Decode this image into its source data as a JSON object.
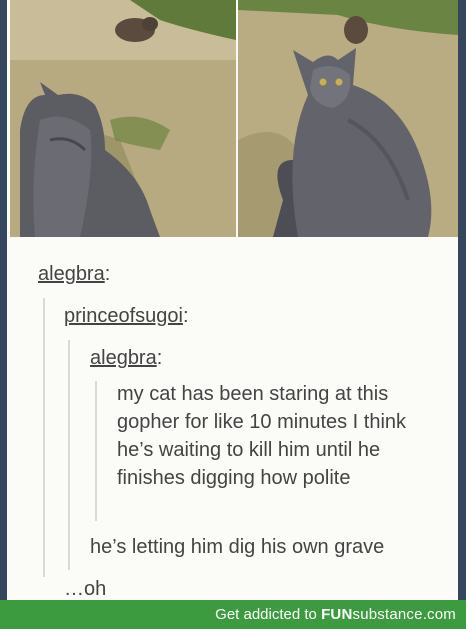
{
  "post": {
    "photos": [
      {
        "name": "cat-watching-gopher-back-view"
      },
      {
        "name": "cat-looking-over-shoulder"
      }
    ],
    "chain": [
      {
        "user": "alegbra",
        "sep": ":"
      },
      {
        "user": "princeofsugoi",
        "sep": ":"
      },
      {
        "user": "alegbra",
        "sep": ":"
      }
    ],
    "quote": "my cat has been staring at this gopher for like 10 minutes I think he’s waiting to kill him until he finishes digging how polite",
    "reply1": "he’s letting him dig his own grave",
    "reply2": "…oh"
  },
  "footer": {
    "tagline": "Get addicted to",
    "brand_main": "FUN",
    "brand_light": "substance",
    "brand_suffix": ".com"
  },
  "colors": {
    "background": "#36465d",
    "card": "#fbfbf8",
    "footer": "#3d9b3f",
    "text": "#444444"
  }
}
